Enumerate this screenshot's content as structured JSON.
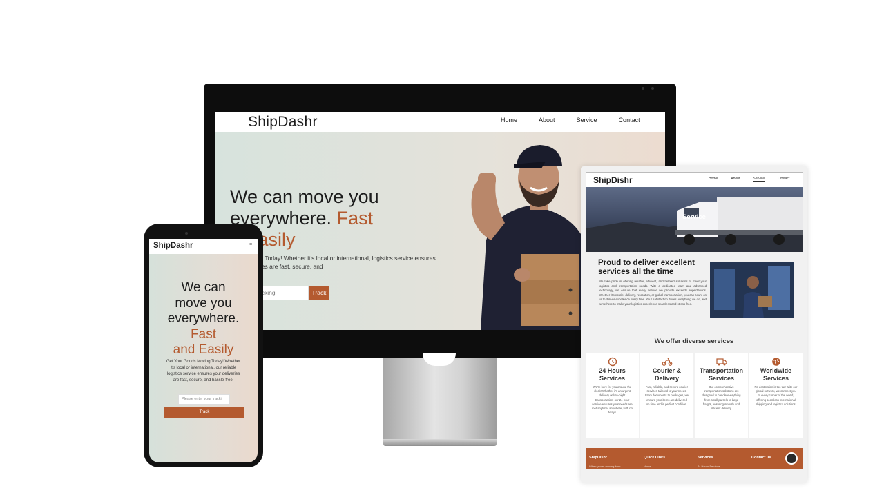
{
  "desktop": {
    "logo": "ShipDashr",
    "nav": [
      {
        "label": "Home",
        "active": true
      },
      {
        "label": "About",
        "active": false
      },
      {
        "label": "Service",
        "active": false
      },
      {
        "label": "Contact",
        "active": false
      }
    ],
    "hero": {
      "title_line1": "We can move you",
      "title_line2": "everywhere.",
      "title_accent1": "Fast",
      "title_accent2": "d Easily",
      "description": "oods Moving Today! Whether it's local or international, logistics service ensures your deliveries are fast, secure, and",
      "track_placeholder": "er your tracking",
      "track_button": "Track"
    }
  },
  "tablet": {
    "logo": "ShipDishr",
    "nav": [
      {
        "label": "Home",
        "active": false
      },
      {
        "label": "About",
        "active": false
      },
      {
        "label": "Service",
        "active": true
      },
      {
        "label": "Contact",
        "active": false
      }
    ],
    "banner_title": "Service",
    "proud_title": "Proud to deliver excellent services all the time",
    "proud_body": "We take pride in offering reliable, efficient, and tailored solutions to meet your logistics and transportation needs. With a dedicated team and advanced technology, we ensure that every service we provide exceeds expectations. Whether it's courier delivery, relocation, or global transportation, you can count on us to deliver excellence every time. Your satisfaction drives everything we do, and we're here to make your logistics experience seamless and stress-free.",
    "offer_title": "We offer diverse services",
    "cards": [
      {
        "icon": "clock-icon",
        "title": "24 Hours Services",
        "desc": "We're here for you around the clock! Whether it's an urgent delivery or late-night transportation, our 24-hour service ensures your needs are met anytime, anywhere, with no delays."
      },
      {
        "icon": "scooter-icon",
        "title": "Courier & Delivery",
        "desc": "Fast, reliable, and secure courier services tailored to your needs. From documents to packages, we ensure your items are delivered on time and in perfect condition."
      },
      {
        "icon": "truck-icon",
        "title": "Transportation Services",
        "desc": "Our comprehensive transportation solutions are designed to handle everything from small parcels to large freight, ensuring smooth and efficient delivery."
      },
      {
        "icon": "globe-icon",
        "title": "Worldwide Services",
        "desc": "No destination is too far! With our global network, we connect you to every corner of the world, offering seamless international shipping and logistics solutions."
      }
    ],
    "footer": {
      "col1": "ShipDishr",
      "col2": "Quick Links",
      "col3": "Services",
      "col4": "Contact us",
      "col1_small": "When you're moving from",
      "col2_small": "Home",
      "col3_small": "24 Hours Services"
    }
  },
  "phone": {
    "logo": "ShipDashr",
    "menu_icon": "≡",
    "title_line1": "We can",
    "title_line2": "move you",
    "title_line3": "everywhere.",
    "title_accent1": "Fast",
    "title_accent2": "and Easily",
    "description": "Get Your Goods Moving Today! Whether it's local or international, our reliable logistics service ensures your deliveries are fast, secure, and hassle-free.",
    "track_placeholder": "Please enter your tracki",
    "track_button": "Track"
  },
  "colors": {
    "accent": "#b45a2f",
    "text": "#1d1d1d"
  }
}
